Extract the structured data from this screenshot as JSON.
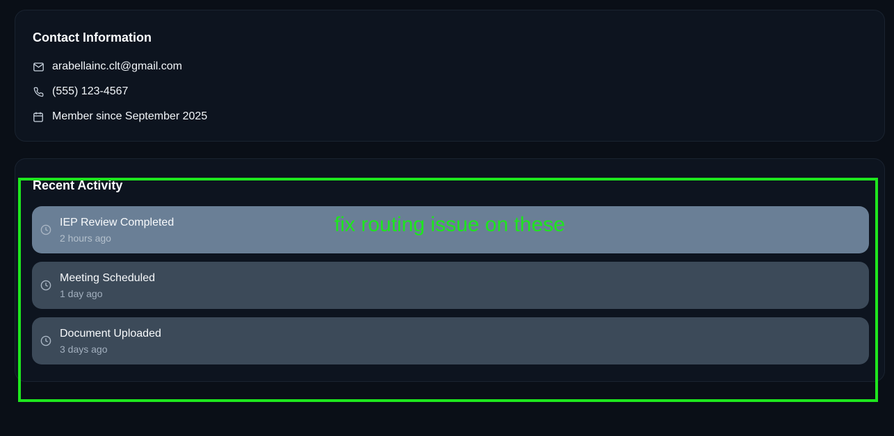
{
  "contact": {
    "title": "Contact Information",
    "items": [
      {
        "icon": "mail-icon",
        "text": "arabellainc.clt@gmail.com"
      },
      {
        "icon": "phone-icon",
        "text": "(555) 123-4567"
      },
      {
        "icon": "calendar-icon",
        "text": "Member since September 2025"
      }
    ]
  },
  "activity": {
    "title": "Recent Activity",
    "items": [
      {
        "icon": "clock-icon",
        "title": "IEP Review Completed",
        "time": "2 hours ago"
      },
      {
        "icon": "clock-icon",
        "title": "Meeting Scheduled",
        "time": "1 day ago"
      },
      {
        "icon": "clock-icon",
        "title": "Document Uploaded",
        "time": "3 days ago"
      }
    ]
  },
  "annotation": {
    "text": "fix routing issue on these",
    "color": "#1ee61e"
  },
  "colors": {
    "background": "#0a0f17",
    "card": "#0d141f",
    "item": "#3c4a59",
    "item_hover": "#6a7f96"
  }
}
